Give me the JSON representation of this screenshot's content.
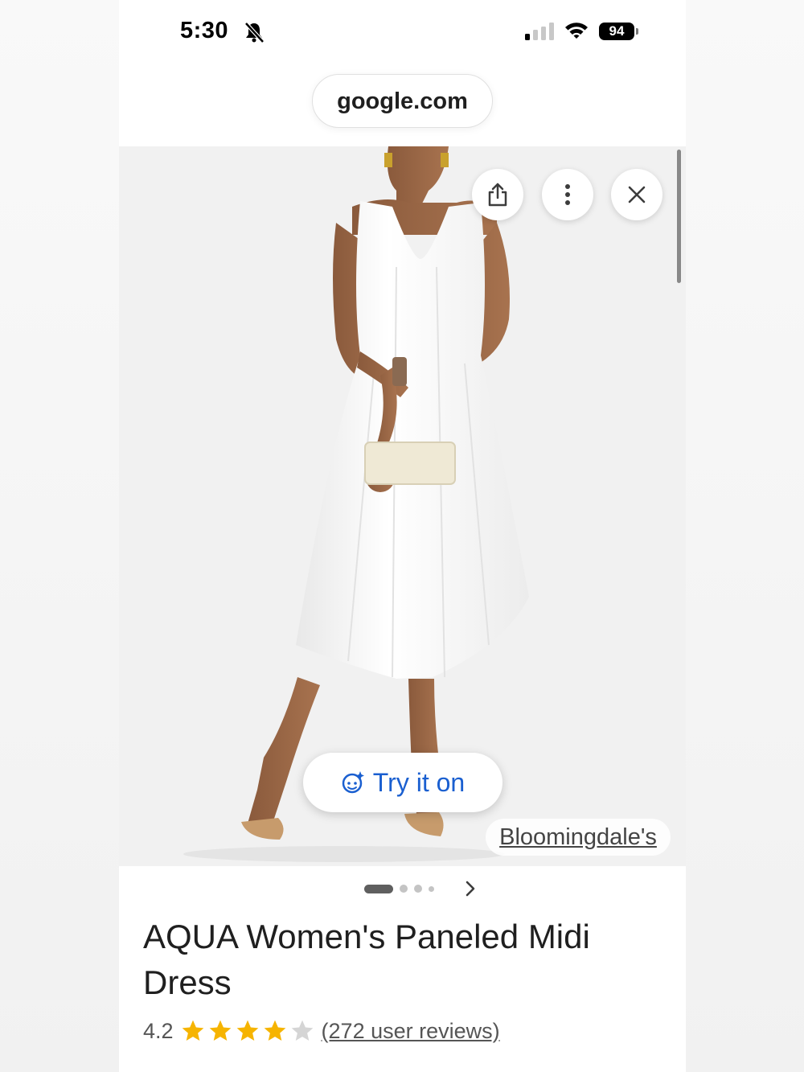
{
  "status_bar": {
    "time": "5:30",
    "battery": "94"
  },
  "browser": {
    "url": "google.com"
  },
  "product": {
    "try_on_label": "Try it on",
    "retailer": "Bloomingdale's",
    "title": "AQUA Women's Paneled Midi Dress",
    "rating": "4.2",
    "rating_value": 4.2,
    "rating_max": 5,
    "reviews_link": "(272 user reviews)"
  },
  "gallery": {
    "image_count": 4,
    "current_index": 1
  },
  "colors": {
    "accent": "#1a5fd0",
    "star": "#f6b400",
    "star_empty": "#d5d5d5"
  },
  "icons": {
    "share": "share-icon",
    "more": "more-vertical-icon",
    "close": "close-icon",
    "try_on": "face-sparkle-icon",
    "next": "chevron-right-icon",
    "silent": "bell-slash-icon",
    "signal": "cellular-signal-icon",
    "wifi": "wifi-icon"
  }
}
